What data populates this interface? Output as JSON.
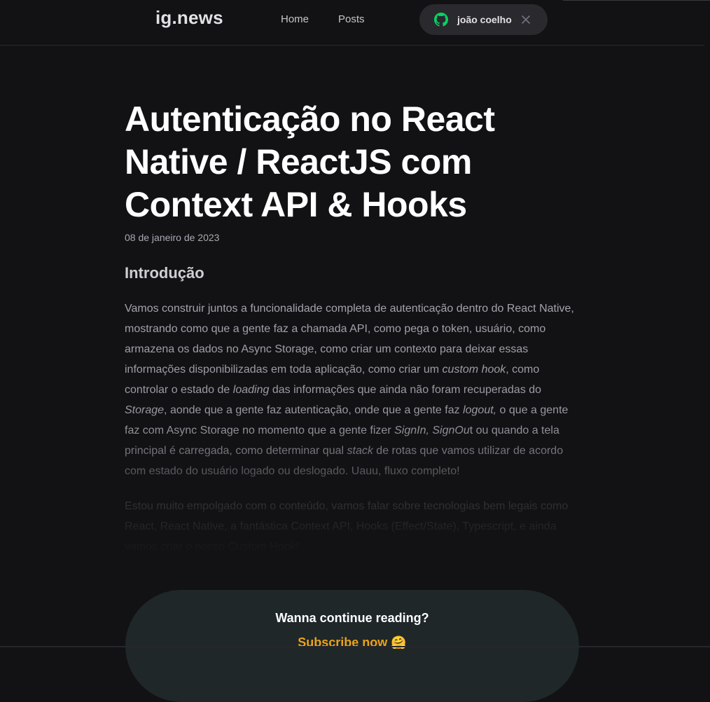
{
  "header": {
    "logo": "ig.news",
    "nav": [
      {
        "label": "Home"
      },
      {
        "label": "Posts"
      }
    ],
    "signin": {
      "username": "joão coelho",
      "icon": "github-icon",
      "icon_color": "#04d361",
      "close_icon": "close-icon"
    }
  },
  "post": {
    "title": "Autenticação no React Native / ReactJS com Context API & Hooks",
    "date": "08 de janeiro de 2023",
    "heading": "Introdução",
    "p1": {
      "t1": "Vamos construir juntos a funcionalidade completa de autenticação dentro do React Native, mostrando como que a gente faz a chamada API, como pega o token, usuário, como armazena os dados no Async Storage, como criar um contexto para deixar essas informações disponibilizadas em toda aplicação, como  criar um ",
      "i1": "custom hook",
      "t2": ", como controlar o estado de ",
      "i2": "loading",
      "t3": " das informações que ainda não foram recuperadas do ",
      "i3": "Storage",
      "t4": ", aonde que a gente faz autenticação, onde que a gente faz ",
      "i4": "logout,",
      "t5": "  o que a gente faz com Async Storage no momento que a gente fizer ",
      "i5": "SignIn, SignOu",
      "t6": "t ou quando a tela principal é carregada, como determinar qual ",
      "i6": "stack",
      "t7": " de rotas que vamos utilizar de acordo com estado do usuário logado ou deslogado. Uauu, fluxo completo!"
    },
    "p2": "Estou muito empolgado com o conteúdo, vamos falar sobre tecnologias bem legais como React, React Native, a fantástica Context API, Hooks (Effect/State), Typescript, e ainda vamos criar o nosso Custom Hook!"
  },
  "cta": {
    "title": "Wanna continue reading?",
    "link": "Subscribe now 🤗",
    "link_color": "#eba417"
  }
}
